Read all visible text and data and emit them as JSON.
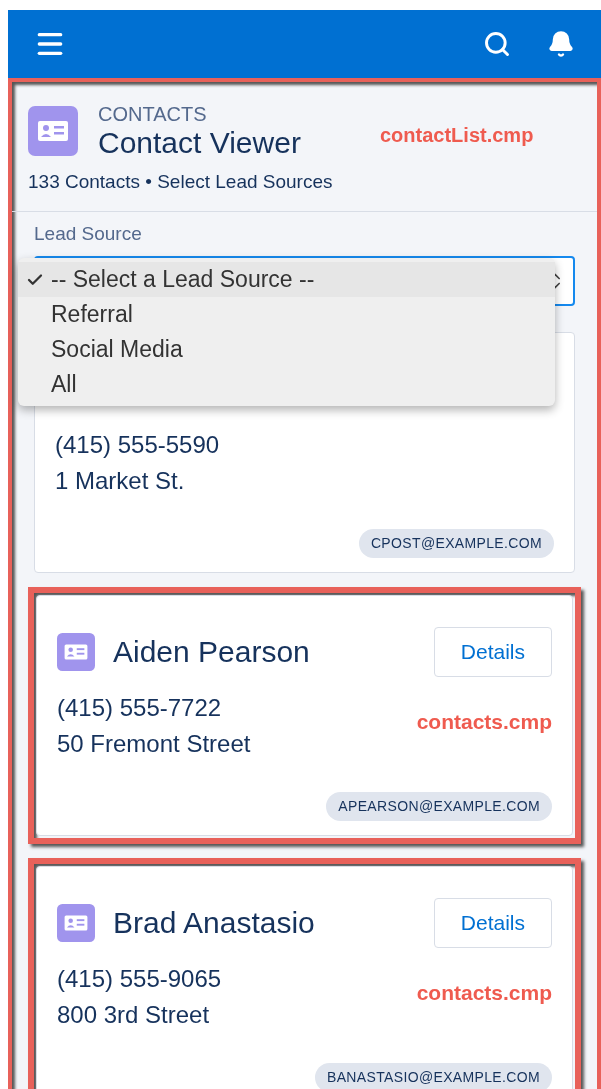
{
  "header": {
    "object_label": "CONTACTS",
    "title": "Contact Viewer",
    "subtitle": "133 Contacts • Select Lead Sources",
    "annotation": "contactList.cmp"
  },
  "filter": {
    "label": "Lead Source",
    "expanded": true,
    "options": [
      {
        "label": "-- Select a Lead Source --",
        "selected": true
      },
      {
        "label": "Referral",
        "selected": false
      },
      {
        "label": "Social Media",
        "selected": false
      },
      {
        "label": "All",
        "selected": false
      }
    ]
  },
  "contacts": [
    {
      "phone": "(415) 555-5590",
      "address": "1 Market St.",
      "email": "CPOST@EXAMPLE.COM"
    },
    {
      "name": "Aiden Pearson",
      "button": "Details",
      "phone": "(415) 555-7722",
      "address": "50 Fremont Street",
      "email": "APEARSON@EXAMPLE.COM",
      "annotation": "contacts.cmp"
    },
    {
      "name": "Brad Anastasio",
      "button": "Details",
      "phone": "(415) 555-9065",
      "address": "800 3rd Street",
      "email": "BANASTASIO@EXAMPLE.COM",
      "annotation": "contacts.cmp"
    }
  ]
}
